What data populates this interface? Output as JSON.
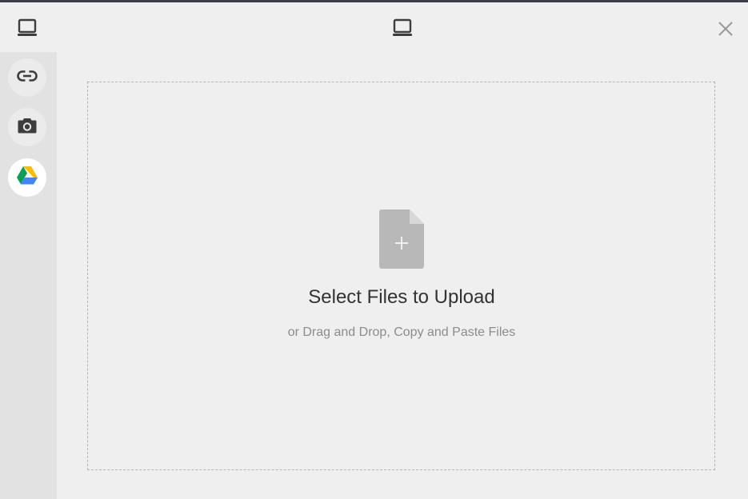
{
  "header": {
    "left_icon": "laptop-icon",
    "center_icon": "laptop-icon",
    "close_icon": "close-icon"
  },
  "sidebar": {
    "items": [
      {
        "id": "link",
        "icon": "link-icon",
        "active": false
      },
      {
        "id": "camera",
        "icon": "camera-icon",
        "active": false
      },
      {
        "id": "google-drive",
        "icon": "google-drive-icon",
        "active": true
      }
    ]
  },
  "dropzone": {
    "icon": "file-plus-icon",
    "title": "Select Files to Upload",
    "subtitle": "or Drag and Drop, Copy and Paste Files"
  },
  "colors": {
    "background": "#efefef",
    "sidebar": "#e2e2e2",
    "icon_dark": "#3d3d3d",
    "file_icon": "#b8b8b8",
    "title_text": "#333333",
    "subtitle_text": "#8c8c8c",
    "drive_yellow": "#fbbc04",
    "drive_green": "#0f9d58",
    "drive_blue": "#4285f4"
  }
}
